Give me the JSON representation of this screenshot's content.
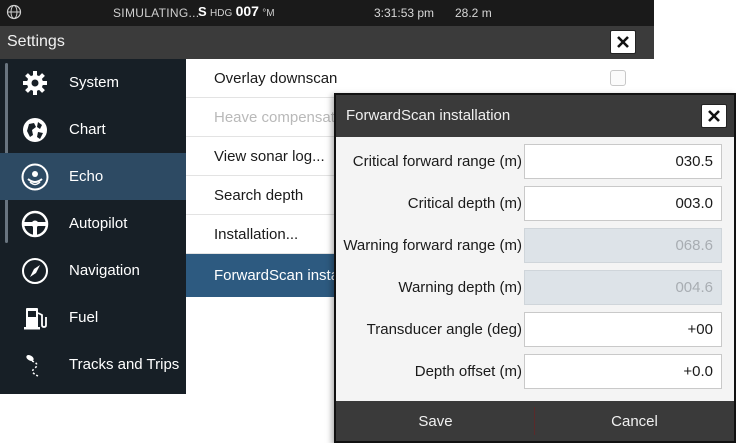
{
  "status_bar": {
    "mode": "SIMULATING...",
    "heading_prefix": "S",
    "heading_label": "HDG",
    "heading_value": "007",
    "heading_unit": "°M",
    "time": "3:31:53 pm",
    "depth": "28.2 m"
  },
  "settings": {
    "title": "Settings",
    "sidebar": [
      {
        "label": "System",
        "icon": "gear-icon",
        "active": false
      },
      {
        "label": "Chart",
        "icon": "chart-globe-icon",
        "active": false
      },
      {
        "label": "Echo",
        "icon": "echo-sonar-icon",
        "active": true
      },
      {
        "label": "Autopilot",
        "icon": "autopilot-wheel-icon",
        "active": false
      },
      {
        "label": "Navigation",
        "icon": "compass-icon",
        "active": false
      },
      {
        "label": "Fuel",
        "icon": "fuel-pump-icon",
        "active": false
      },
      {
        "label": "Tracks and Trips",
        "icon": "track-icon",
        "active": false
      }
    ],
    "rows": [
      {
        "label": "Overlay downscan",
        "disabled": false,
        "selected": false,
        "has_checkbox": true,
        "checked": false
      },
      {
        "label": "Heave compensation",
        "disabled": true,
        "selected": false
      },
      {
        "label": "View sonar log...",
        "disabled": false,
        "selected": false
      },
      {
        "label": "Search depth",
        "disabled": false,
        "selected": false
      },
      {
        "label": "Installation...",
        "disabled": false,
        "selected": false
      },
      {
        "label": "ForwardScan installation",
        "disabled": false,
        "selected": true
      }
    ]
  },
  "dialog": {
    "title": "ForwardScan installation",
    "fields": [
      {
        "label": "Critical forward range (m)",
        "value": "030.5",
        "disabled": false
      },
      {
        "label": "Critical depth (m)",
        "value": "003.0",
        "disabled": false
      },
      {
        "label": "Warning forward range (m)",
        "value": "068.6",
        "disabled": true
      },
      {
        "label": "Warning depth (m)",
        "value": "004.6",
        "disabled": true
      },
      {
        "label": "Transducer angle (deg)",
        "value": "+00",
        "disabled": false
      },
      {
        "label": "Depth offset (m)",
        "value": "+0.0",
        "disabled": false
      }
    ],
    "save_label": "Save",
    "cancel_label": "Cancel"
  },
  "colors": {
    "sidebar_bg": "#171f26",
    "sidebar_active": "#2d4a63",
    "selected_row": "#2d5a80",
    "titlebar": "#3a3a3a"
  }
}
